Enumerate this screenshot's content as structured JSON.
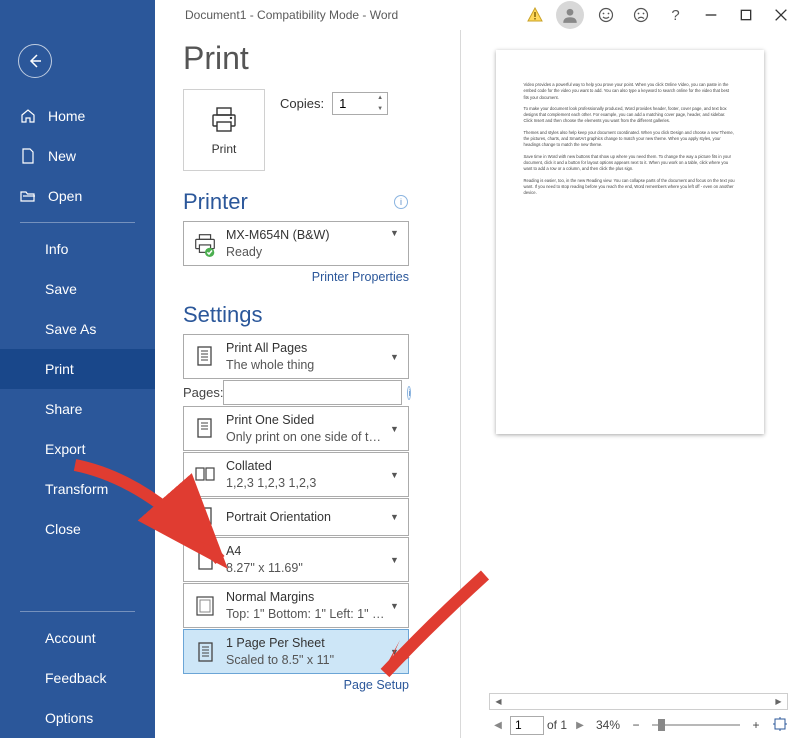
{
  "titlebar": {
    "text": "Document1  -  Compatibility Mode  -  Word"
  },
  "sidebar": {
    "home": "Home",
    "new": "New",
    "open": "Open",
    "info": "Info",
    "save": "Save",
    "save_as": "Save As",
    "print": "Print",
    "share": "Share",
    "export": "Export",
    "transform": "Transform",
    "close": "Close",
    "account": "Account",
    "feedback": "Feedback",
    "options": "Options"
  },
  "page_title": "Print",
  "print_button": "Print",
  "copies": {
    "label": "Copies:",
    "value": "1"
  },
  "printer": {
    "heading": "Printer",
    "name": "MX-M654N (B&W)",
    "status": "Ready",
    "properties_link": "Printer Properties"
  },
  "settings": {
    "heading": "Settings",
    "print_all": {
      "line1": "Print All Pages",
      "line2": "The whole thing"
    },
    "pages_label": "Pages:",
    "sided": {
      "line1": "Print One Sided",
      "line2": "Only print on one side of th…"
    },
    "collated": {
      "line1": "Collated",
      "line2": "1,2,3    1,2,3    1,2,3"
    },
    "orientation": {
      "line1": "Portrait Orientation"
    },
    "paper": {
      "line1": "A4",
      "line2": "8.27\" x 11.69\""
    },
    "margins": {
      "line1": "Normal Margins",
      "line2": "Top: 1\" Bottom: 1\" Left: 1\" Ri…"
    },
    "per_sheet": {
      "line1": "1 Page Per Sheet",
      "line2": "Scaled to 8.5\" x 11\""
    },
    "page_setup_link": "Page Setup"
  },
  "preview": {
    "p1": "Video provides a powerful way to help you prove your point. When you click Online Video, you can paste in the embed code for the video you want to add. You can also type a keyword to search online for the video that best fits your document.",
    "p2": "To make your document look professionally produced, Word provides header, footer, cover page, and text box designs that complement each other. For example, you can add a matching cover page, header, and sidebar. Click Insert and then choose the elements you want from the different galleries.",
    "p3": "Themes and styles also help keep your document coordinated. When you click Design and choose a new Theme, the pictures, charts, and SmartArt graphics change to match your new theme. When you apply styles, your headings change to match the new theme.",
    "p4": "Save time in Word with new buttons that show up where you need them. To change the way a picture fits in your document, click it and a button for layout options appears next to it. When you work on a table, click where you want to add a row or a column, and then click the plus sign.",
    "p5": "Reading is easier, too, in the new Reading view. You can collapse parts of the document and focus on the text you want. If you need to stop reading before you reach the end, Word remembers where you left off - even on another device."
  },
  "footer": {
    "page_current": "1",
    "page_of": "of 1",
    "zoom": "34%"
  }
}
